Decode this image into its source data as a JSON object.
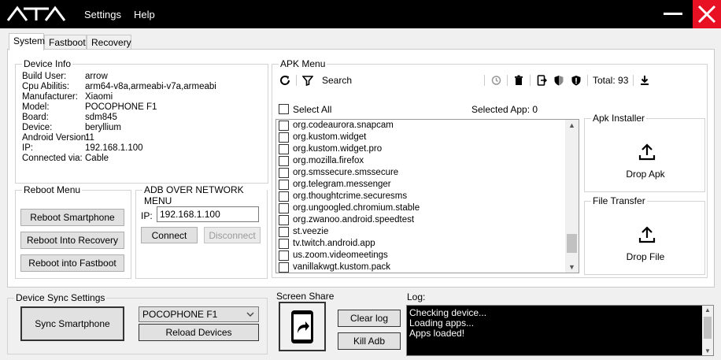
{
  "app": {
    "logo_text": "ATA",
    "menu": [
      "Settings",
      "Help"
    ]
  },
  "tabs": [
    "System",
    "Fastboot",
    "Recovery"
  ],
  "device_info": {
    "title": "Device Info",
    "rows": [
      {
        "label": "Build User:",
        "value": "arrow"
      },
      {
        "label": "Cpu Abilitis:",
        "value": "arm64-v8a,armeabi-v7a,armeabi"
      },
      {
        "label": "Manufacturer:",
        "value": "Xiaomi"
      },
      {
        "label": "Model:",
        "value": "POCOPHONE F1"
      },
      {
        "label": "Board:",
        "value": "sdm845"
      },
      {
        "label": "Device:",
        "value": "beryllium"
      },
      {
        "label": "Android Version:",
        "value": "11"
      },
      {
        "label": "IP:",
        "value": "192.168.1.100"
      },
      {
        "label": "Connected via:",
        "value": "Cable"
      }
    ]
  },
  "reboot_menu": {
    "title": "Reboot Menu",
    "buttons": [
      "Reboot Smartphone",
      "Reboot Into Recovery",
      "Reboot into Fastboot"
    ]
  },
  "adb_network": {
    "title": "ADB OVER NETWORK MENU",
    "ip_label": "IP:",
    "ip_value": "192.168.1.100",
    "connect": "Connect",
    "disconnect": "Disconnect"
  },
  "apk_menu": {
    "title": "APK Menu",
    "search_label": "Search",
    "total_label": "Total: 93",
    "select_all": "Select All",
    "selected_app": "Selected App: 0",
    "apps": [
      "org.codeaurora.snapcam",
      "org.kustom.widget",
      "org.kustom.widget.pro",
      "org.mozilla.firefox",
      "org.smssecure.smssecure",
      "org.telegram.messenger",
      "org.thoughtcrime.securesms",
      "org.ungoogled.chromium.stable",
      "org.zwanoo.android.speedtest",
      "st.veezie",
      "tv.twitch.android.app",
      "us.zoom.videomeetings",
      "vanillakwgt.kustom.pack"
    ],
    "scroll_position": 0.92
  },
  "apk_installer": {
    "title": "Apk Installer",
    "label": "Drop Apk"
  },
  "file_transfer": {
    "title": "File Transfer",
    "label": "Drop File"
  },
  "device_sync": {
    "title": "Device Sync Settings",
    "sync_button": "Sync Smartphone",
    "device_select": "POCOPHONE F1",
    "reload": "Reload Devices"
  },
  "screen_share": {
    "title": "Screen Share"
  },
  "log_actions": {
    "clear": "Clear log",
    "kill": "Kill Adb"
  },
  "log": {
    "title": "Log:",
    "lines": [
      "Checking device...",
      "Loading apps...",
      "Apps loaded!"
    ]
  },
  "colors": {
    "close": "#e81123",
    "titlebar": "#000000",
    "log_bg": "#000000"
  }
}
